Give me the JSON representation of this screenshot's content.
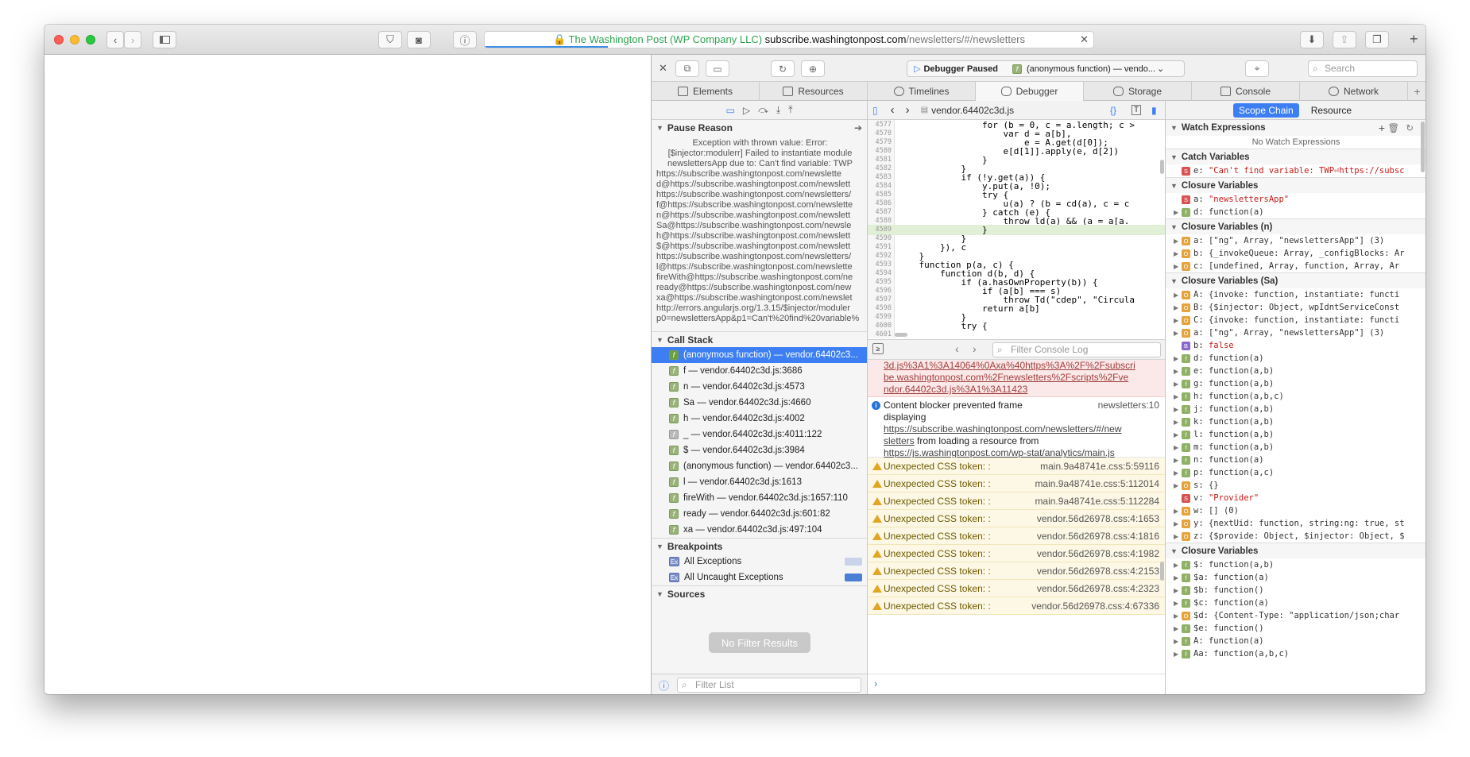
{
  "browser": {
    "url_owner": "The Washington Post (WP Company LLC)",
    "url_host": "subscribe.washingtonpost.com",
    "url_path": "/newsletters/#/newsletters"
  },
  "toolbar": {
    "paused_label": "Debugger Paused",
    "frame_label": "(anonymous function) — vendo...",
    "search_placeholder": "Search"
  },
  "tabs": [
    "Elements",
    "Resources",
    "Timelines",
    "Debugger",
    "Storage",
    "Console",
    "Network"
  ],
  "pause": {
    "title": "Pause Reason",
    "lines": [
      "Exception with thrown value: Error:",
      "[$injector:modulerr] Failed to instantiate module",
      "newslettersApp due to: Can't find variable: TWP",
      "https://subscribe.washingtonpost.com/newslette",
      "d@https://subscribe.washingtonpost.com/newslett",
      "https://subscribe.washingtonpost.com/newsletters/",
      "f@https://subscribe.washingtonpost.com/newslette",
      "n@https://subscribe.washingtonpost.com/newslett",
      "Sa@https://subscribe.washingtonpost.com/newsle",
      "h@https://subscribe.washingtonpost.com/newslett",
      "$@https://subscribe.washingtonpost.com/newslett",
      "https://subscribe.washingtonpost.com/newsletters/",
      "l@https://subscribe.washingtonpost.com/newslette",
      "fireWith@https://subscribe.washingtonpost.com/ne",
      "ready@https://subscribe.washingtonpost.com/new",
      "xa@https://subscribe.washingtonpost.com/newslet",
      "http://errors.angularjs.org/1.3.15/$injector/moduler",
      "p0=newslettersApp&p1=Can't%20find%20variable%"
    ]
  },
  "callstack": {
    "title": "Call Stack",
    "frames": [
      "(anonymous function) — vendor.64402c3...",
      "f — vendor.64402c3d.js:3686",
      "n — vendor.64402c3d.js:4573",
      "Sa — vendor.64402c3d.js:4660",
      "h — vendor.64402c3d.js:4002",
      "_ — vendor.64402c3d.js:4011:122",
      "$ — vendor.64402c3d.js:3984",
      "(anonymous function) — vendor.64402c3...",
      "l — vendor.64402c3d.js:1613",
      "fireWith — vendor.64402c3d.js:1657:110",
      "ready — vendor.64402c3d.js:601:82",
      "xa — vendor.64402c3d.js:497:104"
    ]
  },
  "breakpoints": {
    "title": "Breakpoints",
    "items": [
      "All Exceptions",
      "All Uncaught Exceptions"
    ]
  },
  "sources": {
    "title": "Sources",
    "no_results": "No Filter Results",
    "filter_placeholder": "Filter List"
  },
  "editor": {
    "filename": "vendor.64402c3d.js",
    "lines": [
      {
        "n": "4577",
        "t": "                for (b = 0, c = a.length; c >"
      },
      {
        "n": "4578",
        "t": "                    var d = a[b],"
      },
      {
        "n": "4579",
        "t": "                        e = A.get(d[0]);"
      },
      {
        "n": "4580",
        "t": "                    e[d[1]].apply(e, d[2])"
      },
      {
        "n": "4581",
        "t": "                }"
      },
      {
        "n": "4582",
        "t": "            }"
      },
      {
        "n": "4583",
        "t": "            if (!y.get(a)) {"
      },
      {
        "n": "4584",
        "t": "                y.put(a, !0);"
      },
      {
        "n": "4585",
        "t": "                try {"
      },
      {
        "n": "4586",
        "t": "                    u(a) ? (b = cd(a), c = c"
      },
      {
        "n": "4587",
        "t": "                } catch (e) {"
      },
      {
        "n": "4588",
        "t": "                    throw ld(a) && (a = a[a."
      },
      {
        "n": "4589",
        "t": "                }"
      },
      {
        "n": "4590",
        "t": "            }"
      },
      {
        "n": "4591",
        "t": "        }), c"
      },
      {
        "n": "4592",
        "t": "    }"
      },
      {
        "n": "4593",
        "t": "    function p(a, c) {"
      },
      {
        "n": "4594",
        "t": "        function d(b, d) {"
      },
      {
        "n": "4595",
        "t": "            if (a.hasOwnProperty(b)) {"
      },
      {
        "n": "4596",
        "t": "                if (a[b] === s)"
      },
      {
        "n": "4597",
        "t": "                    throw Td(\"cdep\", \"Circula"
      },
      {
        "n": "4598",
        "t": "                return a[b]"
      },
      {
        "n": "4599",
        "t": "            }"
      },
      {
        "n": "4600",
        "t": "            try {"
      },
      {
        "n": "4601",
        "t": ""
      }
    ]
  },
  "console": {
    "filter_placeholder": "Filter Console Log",
    "error_lines": [
      "3d.js%3A1%3A14064%0Axa%40https%3A%2F%2Fsubscri",
      "be.washingtonpost.com%2Fnewsletters%2Fscripts%2Fve",
      "ndor.64402c3d.js%3A1%3A11423"
    ],
    "info": {
      "text1": "Content blocker prevented frame",
      "text2": "displaying",
      "link1": "https://subscribe.washingtonpost.com/newsletters/#/new",
      "link1b": "sletters",
      "text3": "from loading a resource from",
      "link2": "https://js.washingtonpost.com/wp-stat/analytics/main.js",
      "source": "newsletters:10"
    },
    "warnings": [
      {
        "msg": "Unexpected CSS token: :",
        "src": "main.9a48741e.css:5:59116"
      },
      {
        "msg": "Unexpected CSS token: :",
        "src": "main.9a48741e.css:5:112014"
      },
      {
        "msg": "Unexpected CSS token: :",
        "src": "main.9a48741e.css:5:112284"
      },
      {
        "msg": "Unexpected CSS token: :",
        "src": "vendor.56d26978.css:4:1653"
      },
      {
        "msg": "Unexpected CSS token: :",
        "src": "vendor.56d26978.css:4:1816"
      },
      {
        "msg": "Unexpected CSS token: :",
        "src": "vendor.56d26978.css:4:1982"
      },
      {
        "msg": "Unexpected CSS token: :",
        "src": "vendor.56d26978.css:4:2153"
      },
      {
        "msg": "Unexpected CSS token: :",
        "src": "vendor.56d26978.css:4:2323"
      },
      {
        "msg": "Unexpected CSS token: :",
        "src": "vendor.56d26978.css:4:67336"
      }
    ]
  },
  "sidebar": {
    "tab_scope": "Scope Chain",
    "tab_resource": "Resource",
    "watch_title": "Watch Expressions",
    "watch_empty": "No Watch Expressions",
    "catch_title": "Catch Variables",
    "catch_var": {
      "n": "e:",
      "v": "\"Can't find variable: TWP⏎https://subsc"
    },
    "closure1_title": "Closure Variables",
    "closure1": [
      {
        "t": "s",
        "n": "a:",
        "v": "\"newslettersApp\""
      },
      {
        "t": "f",
        "n": "d:",
        "v": "function(a)",
        "arrow": true
      }
    ],
    "closure2_title": "Closure Variables (n)",
    "closure2": [
      {
        "t": "o",
        "n": "a:",
        "v": "[\"ng\", Array, \"newslettersApp\"] (3)"
      },
      {
        "t": "o",
        "n": "b:",
        "v": "{_invokeQueue: Array, _configBlocks: Ar"
      },
      {
        "t": "o",
        "n": "c:",
        "v": "[undefined, Array, function, Array, Ar"
      }
    ],
    "closure3_title": "Closure Variables (Sa)",
    "closure3": [
      {
        "t": "o",
        "n": "A:",
        "v": "{invoke: function, instantiate: functi"
      },
      {
        "t": "o",
        "n": "B:",
        "v": "{$injector: Object, wpIdntServiceConst"
      },
      {
        "t": "o",
        "n": "C:",
        "v": "{invoke: function, instantiate: functi"
      },
      {
        "t": "o",
        "n": "a:",
        "v": "[\"ng\", Array, \"newslettersApp\"] (3)"
      },
      {
        "t": "b",
        "n": "b:",
        "v": "false"
      },
      {
        "t": "f",
        "n": "d:",
        "v": "function(a)"
      },
      {
        "t": "f",
        "n": "e:",
        "v": "function(a,b)"
      },
      {
        "t": "f",
        "n": "g:",
        "v": "function(a,b)"
      },
      {
        "t": "f",
        "n": "h:",
        "v": "function(a,b,c)"
      },
      {
        "t": "f",
        "n": "j:",
        "v": "function(a,b)"
      },
      {
        "t": "f",
        "n": "k:",
        "v": "function(a,b)"
      },
      {
        "t": "f",
        "n": "l:",
        "v": "function(a,b)"
      },
      {
        "t": "f",
        "n": "m:",
        "v": "function(a,b)"
      },
      {
        "t": "f",
        "n": "n:",
        "v": "function(a)"
      },
      {
        "t": "f",
        "n": "p:",
        "v": "function(a,c)"
      },
      {
        "t": "o",
        "n": "s:",
        "v": "{}"
      },
      {
        "t": "s",
        "n": "v:",
        "v": "\"Provider\""
      },
      {
        "t": "o",
        "n": "w:",
        "v": "[] (0)"
      },
      {
        "t": "o",
        "n": "y:",
        "v": "{nextUid: function, string:ng: true, st"
      },
      {
        "t": "o",
        "n": "z:",
        "v": "{$provide: Object, $injector: Object, $"
      }
    ],
    "closure4_title": "Closure Variables",
    "closure4": [
      {
        "t": "f",
        "n": "$:",
        "v": "function(a,b)"
      },
      {
        "t": "f",
        "n": "$a:",
        "v": "function(a)"
      },
      {
        "t": "f",
        "n": "$b:",
        "v": "function()"
      },
      {
        "t": "f",
        "n": "$c:",
        "v": "function(a)"
      },
      {
        "t": "o",
        "n": "$d:",
        "v": "{Content-Type: \"application/json;char"
      },
      {
        "t": "f",
        "n": "$e:",
        "v": "function()"
      },
      {
        "t": "f",
        "n": "A:",
        "v": "function(a)"
      },
      {
        "t": "f",
        "n": "Aa:",
        "v": "function(a,b,c)"
      }
    ]
  }
}
